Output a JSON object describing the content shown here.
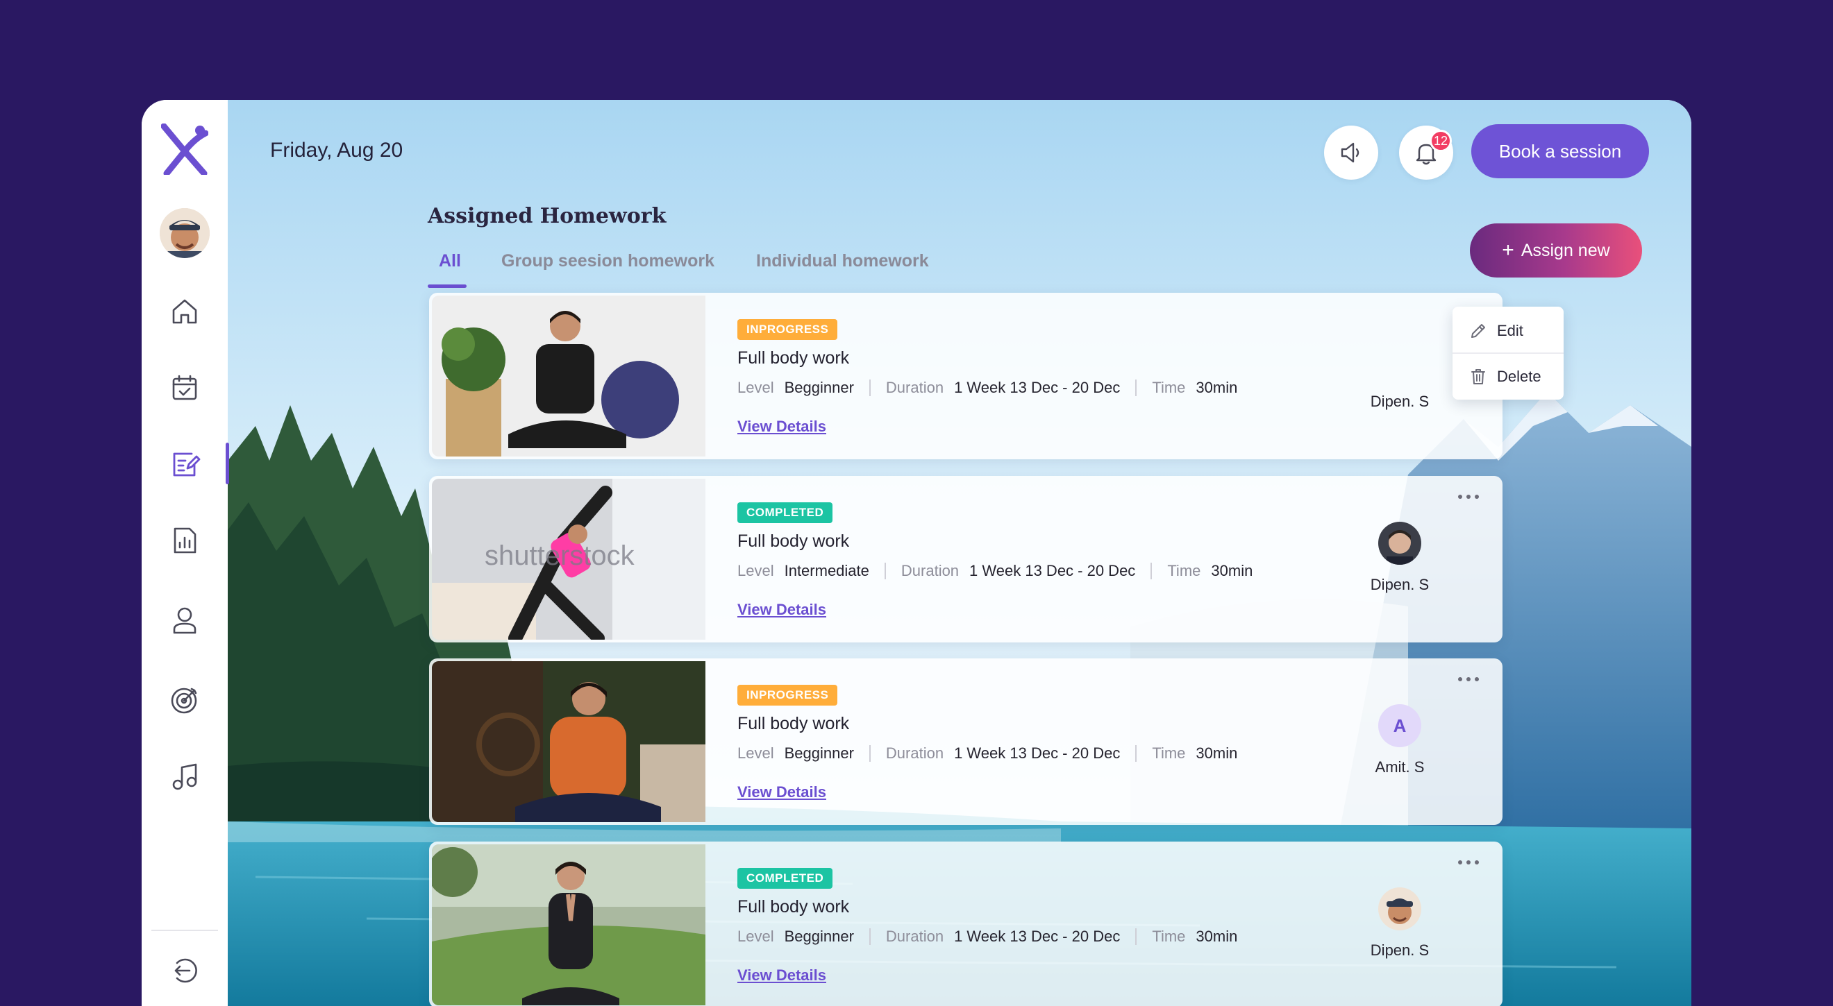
{
  "header": {
    "date": "Friday, Aug 20",
    "notifications_count": "12",
    "book_label": "Book a session"
  },
  "sidebar": {
    "items": [
      {
        "name": "home",
        "icon": "home-icon"
      },
      {
        "name": "calendar",
        "icon": "calendar-check-icon"
      },
      {
        "name": "homework",
        "icon": "edit-note-icon",
        "active": true
      },
      {
        "name": "reports",
        "icon": "bar-chart-icon"
      },
      {
        "name": "profile",
        "icon": "user-icon"
      },
      {
        "name": "goals",
        "icon": "target-icon"
      },
      {
        "name": "music",
        "icon": "music-note-icon"
      }
    ],
    "logout_icon": "logout-icon"
  },
  "section": {
    "title": "Assigned Homework",
    "tabs": [
      "All",
      "Group seesion homework",
      "Individual homework"
    ],
    "active_tab": "All",
    "assign_label": "Assign new"
  },
  "menu": {
    "edit_label": "Edit",
    "delete_label": "Delete"
  },
  "labels": {
    "level": "Level",
    "duration": "Duration",
    "time": "Time",
    "view_details": "View Details"
  },
  "cards": [
    {
      "status": "INPROGRESS",
      "title": "Full body work",
      "level": "Begginner",
      "duration": "1 Week 13 Dec - 20 Dec",
      "time": "30min",
      "assignee": "Dipen. S",
      "avatar": "photo"
    },
    {
      "status": "COMPLETED",
      "title": "Full body work",
      "level": "Intermediate",
      "duration": "1 Week 13 Dec - 20 Dec",
      "time": "30min",
      "assignee": "Dipen. S",
      "avatar": "photo"
    },
    {
      "status": "INPROGRESS",
      "title": "Full body work",
      "level": "Begginner",
      "duration": "1 Week 13 Dec - 20 Dec",
      "time": "30min",
      "assignee": "Amit. S",
      "avatar": "A"
    },
    {
      "status": "COMPLETED",
      "title": "Full body work",
      "level": "Begginner",
      "duration": "1 Week 13 Dec - 20 Dec",
      "time": "30min",
      "assignee": "Dipen. S",
      "avatar": "photo"
    }
  ],
  "thumb_watermark": "shutterstock",
  "colors": {
    "accent": "#6b4fd1",
    "background": "#2a1862",
    "inprogress": "#ffad3a",
    "completed": "#1cc4a3",
    "badge": "#f23d63"
  }
}
